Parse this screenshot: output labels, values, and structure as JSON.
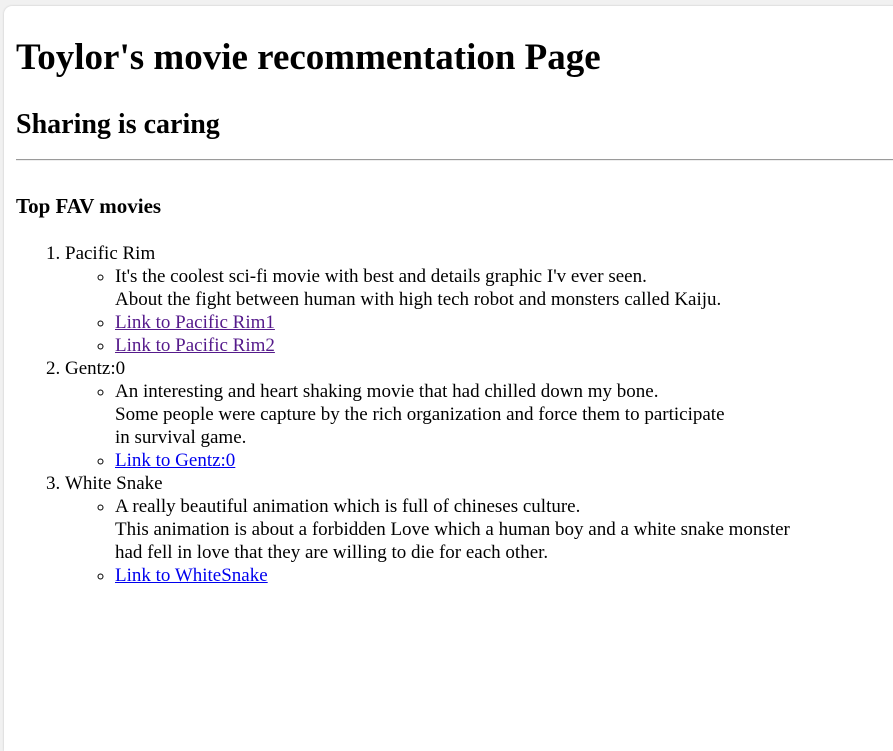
{
  "page": {
    "title": "Toylor's movie recommentation Page",
    "subtitle": "Sharing is caring",
    "section_title": "Top FAV movies"
  },
  "movies": [
    {
      "name": "Pacific Rim",
      "description": [
        "It's the coolest sci-fi movie with best and details graphic I'v ever seen.",
        "About the fight between human with high tech robot and monsters called Kaiju."
      ],
      "links": [
        {
          "label": "Link to Pacific Rim1",
          "visited": true
        },
        {
          "label": "Link to Pacific Rim2",
          "visited": true
        }
      ]
    },
    {
      "name": "Gentz:0",
      "description": [
        "An interesting and heart shaking movie that had chilled down my bone.",
        "Some people were capture by the rich organization and force them to participate",
        "in survival game."
      ],
      "links": [
        {
          "label": "Link to Gentz:0",
          "visited": false
        }
      ]
    },
    {
      "name": "White Snake",
      "description": [
        "A really beautiful animation which is full of chineses culture.",
        "This animation is about a forbidden Love which a human boy and a white snake monster",
        "had fell in love that they are willing to die for each other."
      ],
      "links": [
        {
          "label": "Link to WhiteSnake",
          "visited": false
        }
      ]
    }
  ],
  "colors": {
    "visited_link": "#551a8b",
    "unvisited_link": "#0000ee",
    "text": "#000000",
    "background": "#ffffff"
  }
}
